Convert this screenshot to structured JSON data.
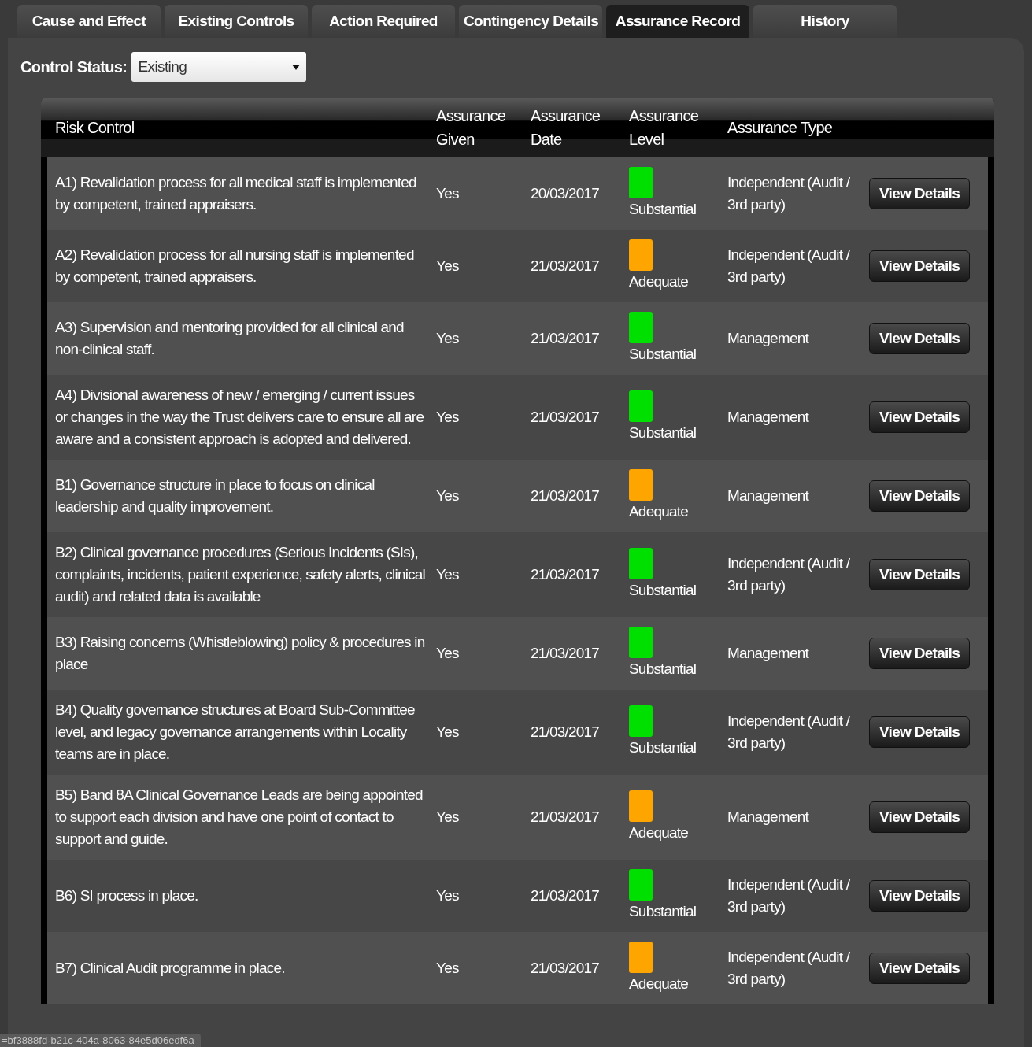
{
  "tabs": [
    {
      "label": "Cause and Effect",
      "selected": false
    },
    {
      "label": "Existing Controls",
      "selected": false
    },
    {
      "label": "Action Required",
      "selected": false
    },
    {
      "label": "Contingency Details",
      "selected": false
    },
    {
      "label": "Assurance Record",
      "selected": true
    },
    {
      "label": "History",
      "selected": false
    }
  ],
  "filter": {
    "label": "Control Status:",
    "value": "Existing"
  },
  "table": {
    "columns": [
      "Risk Control",
      "Assurance Given",
      "Assurance Date",
      "Assurance Level",
      "Assurance Type"
    ],
    "rows": [
      {
        "control": "A1) Revalidation process for all medical staff is implemented by competent, trained appraisers.",
        "given": "Yes",
        "date": "20/03/2017",
        "level": "Substantial",
        "color": "#00e000",
        "type": "Independent (Audit / 3rd party)",
        "action": "View Details"
      },
      {
        "control": "A2) Revalidation process for all nursing staff is implemented by competent, trained appraisers.",
        "given": "Yes",
        "date": "21/03/2017",
        "level": "Adequate",
        "color": "#ffa500",
        "type": "Independent (Audit / 3rd party)",
        "action": "View Details"
      },
      {
        "control": "A3) Supervision and mentoring provided for all clinical and non-clinical staff.",
        "given": "Yes",
        "date": "21/03/2017",
        "level": "Substantial",
        "color": "#00e000",
        "type": "Management",
        "action": "View Details"
      },
      {
        "control": "A4) Divisional awareness of new / emerging / current issues or changes in the way the Trust delivers care to ensure all are aware and a consistent approach is adopted and delivered.",
        "given": "Yes",
        "date": "21/03/2017",
        "level": "Substantial",
        "color": "#00e000",
        "type": "Management",
        "action": "View Details"
      },
      {
        "control": "B1) Governance structure in place to focus on clinical leadership and quality improvement.",
        "given": "Yes",
        "date": "21/03/2017",
        "level": "Adequate",
        "color": "#ffa500",
        "type": "Management",
        "action": "View Details"
      },
      {
        "control": "B2) Clinical governance procedures (Serious Incidents (SIs), complaints, incidents, patient experience, safety alerts, clinical audit) and related data is available",
        "given": "Yes",
        "date": "21/03/2017",
        "level": "Substantial",
        "color": "#00e000",
        "type": "Independent (Audit / 3rd party)",
        "action": "View Details"
      },
      {
        "control": "B3) Raising concerns (Whistleblowing) policy & procedures in place",
        "given": "Yes",
        "date": "21/03/2017",
        "level": "Substantial",
        "color": "#00e000",
        "type": "Management",
        "action": "View Details"
      },
      {
        "control": "B4) Quality governance structures at Board Sub-Committee level, and legacy governance arrangements within Locality teams are in place.",
        "given": "Yes",
        "date": "21/03/2017",
        "level": "Substantial",
        "color": "#00e000",
        "type": "Independent (Audit / 3rd party)",
        "action": "View Details"
      },
      {
        "control": "B5) Band 8A Clinical Governance Leads are being appointed to support each division and have one point of contact to support and guide.",
        "given": "Yes",
        "date": "21/03/2017",
        "level": "Adequate",
        "color": "#ffa500",
        "type": "Management",
        "action": "View Details"
      },
      {
        "control": "B6) SI process in place.",
        "given": "Yes",
        "date": "21/03/2017",
        "level": "Substantial",
        "color": "#00e000",
        "type": "Independent (Audit / 3rd party)",
        "action": "View Details"
      },
      {
        "control": "B7) Clinical Audit programme in place.",
        "given": "Yes",
        "date": "21/03/2017",
        "level": "Adequate",
        "color": "#ffa500",
        "type": "Independent (Audit / 3rd party)",
        "action": "View Details"
      }
    ]
  },
  "status_bar": {
    "text": "=bf3888fd-b21c-404a-8063-84e5d06edf6a"
  }
}
